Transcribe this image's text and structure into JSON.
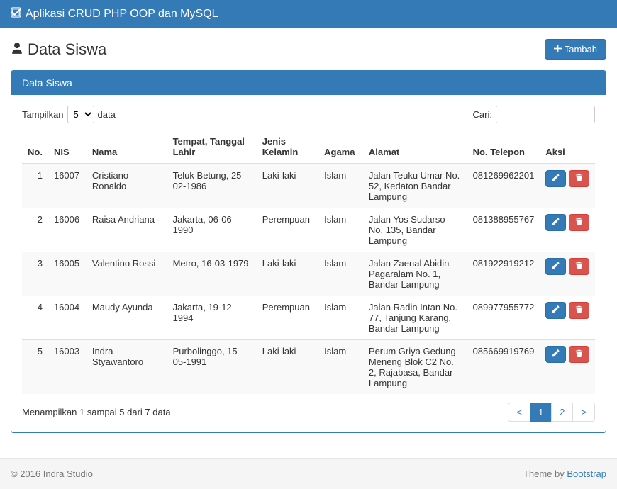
{
  "navbar": {
    "title": "Aplikasi CRUD PHP OOP dan MySQL"
  },
  "page": {
    "title": "Data Siswa",
    "add_button": "Tambah"
  },
  "panel": {
    "heading": "Data Siswa"
  },
  "datatable": {
    "length_prefix": "Tampilkan",
    "length_suffix": "data",
    "length_value": "5",
    "search_label": "Cari:",
    "search_value": "",
    "info": "Menampilkan 1 sampai 5 dari 7 data",
    "headers": {
      "no": "No.",
      "nis": "NIS",
      "nama": "Nama",
      "ttl": "Tempat, Tanggal Lahir",
      "jk": "Jenis Kelamin",
      "agama": "Agama",
      "alamat": "Alamat",
      "telepon": "No. Telepon",
      "aksi": "Aksi"
    },
    "rows": [
      {
        "no": "1",
        "nis": "16007",
        "nama": "Cristiano Ronaldo",
        "ttl": "Teluk Betung, 25-02-1986",
        "jk": "Laki-laki",
        "agama": "Islam",
        "alamat": "Jalan Teuku Umar No. 52, Kedaton Bandar Lampung",
        "telepon": "081269962201"
      },
      {
        "no": "2",
        "nis": "16006",
        "nama": "Raisa Andriana",
        "ttl": "Jakarta, 06-06-1990",
        "jk": "Perempuan",
        "agama": "Islam",
        "alamat": "Jalan Yos Sudarso No. 135, Bandar Lampung",
        "telepon": "081388955767"
      },
      {
        "no": "3",
        "nis": "16005",
        "nama": "Valentino Rossi",
        "ttl": "Metro, 16-03-1979",
        "jk": "Laki-laki",
        "agama": "Islam",
        "alamat": "Jalan Zaenal Abidin Pagaralam No. 1, Bandar Lampung",
        "telepon": "081922919212"
      },
      {
        "no": "4",
        "nis": "16004",
        "nama": "Maudy Ayunda",
        "ttl": "Jakarta, 19-12-1994",
        "jk": "Perempuan",
        "agama": "Islam",
        "alamat": "Jalan Radin Intan No. 77, Tanjung Karang, Bandar Lampung",
        "telepon": "089977955772"
      },
      {
        "no": "5",
        "nis": "16003",
        "nama": "Indra Styawantoro",
        "ttl": "Purbolinggo, 15-05-1991",
        "jk": "Laki-laki",
        "agama": "Islam",
        "alamat": "Perum Griya Gedung Meneng Blok C2 No. 2, Rajabasa, Bandar Lampung",
        "telepon": "085669919769"
      }
    ],
    "pagination": {
      "prev": "<",
      "next": ">",
      "pages": [
        "1",
        "2"
      ],
      "active": "1"
    }
  },
  "footer": {
    "left": "© 2016 Indra Studio",
    "right_prefix": "Theme by ",
    "right_link": "Bootstrap"
  }
}
